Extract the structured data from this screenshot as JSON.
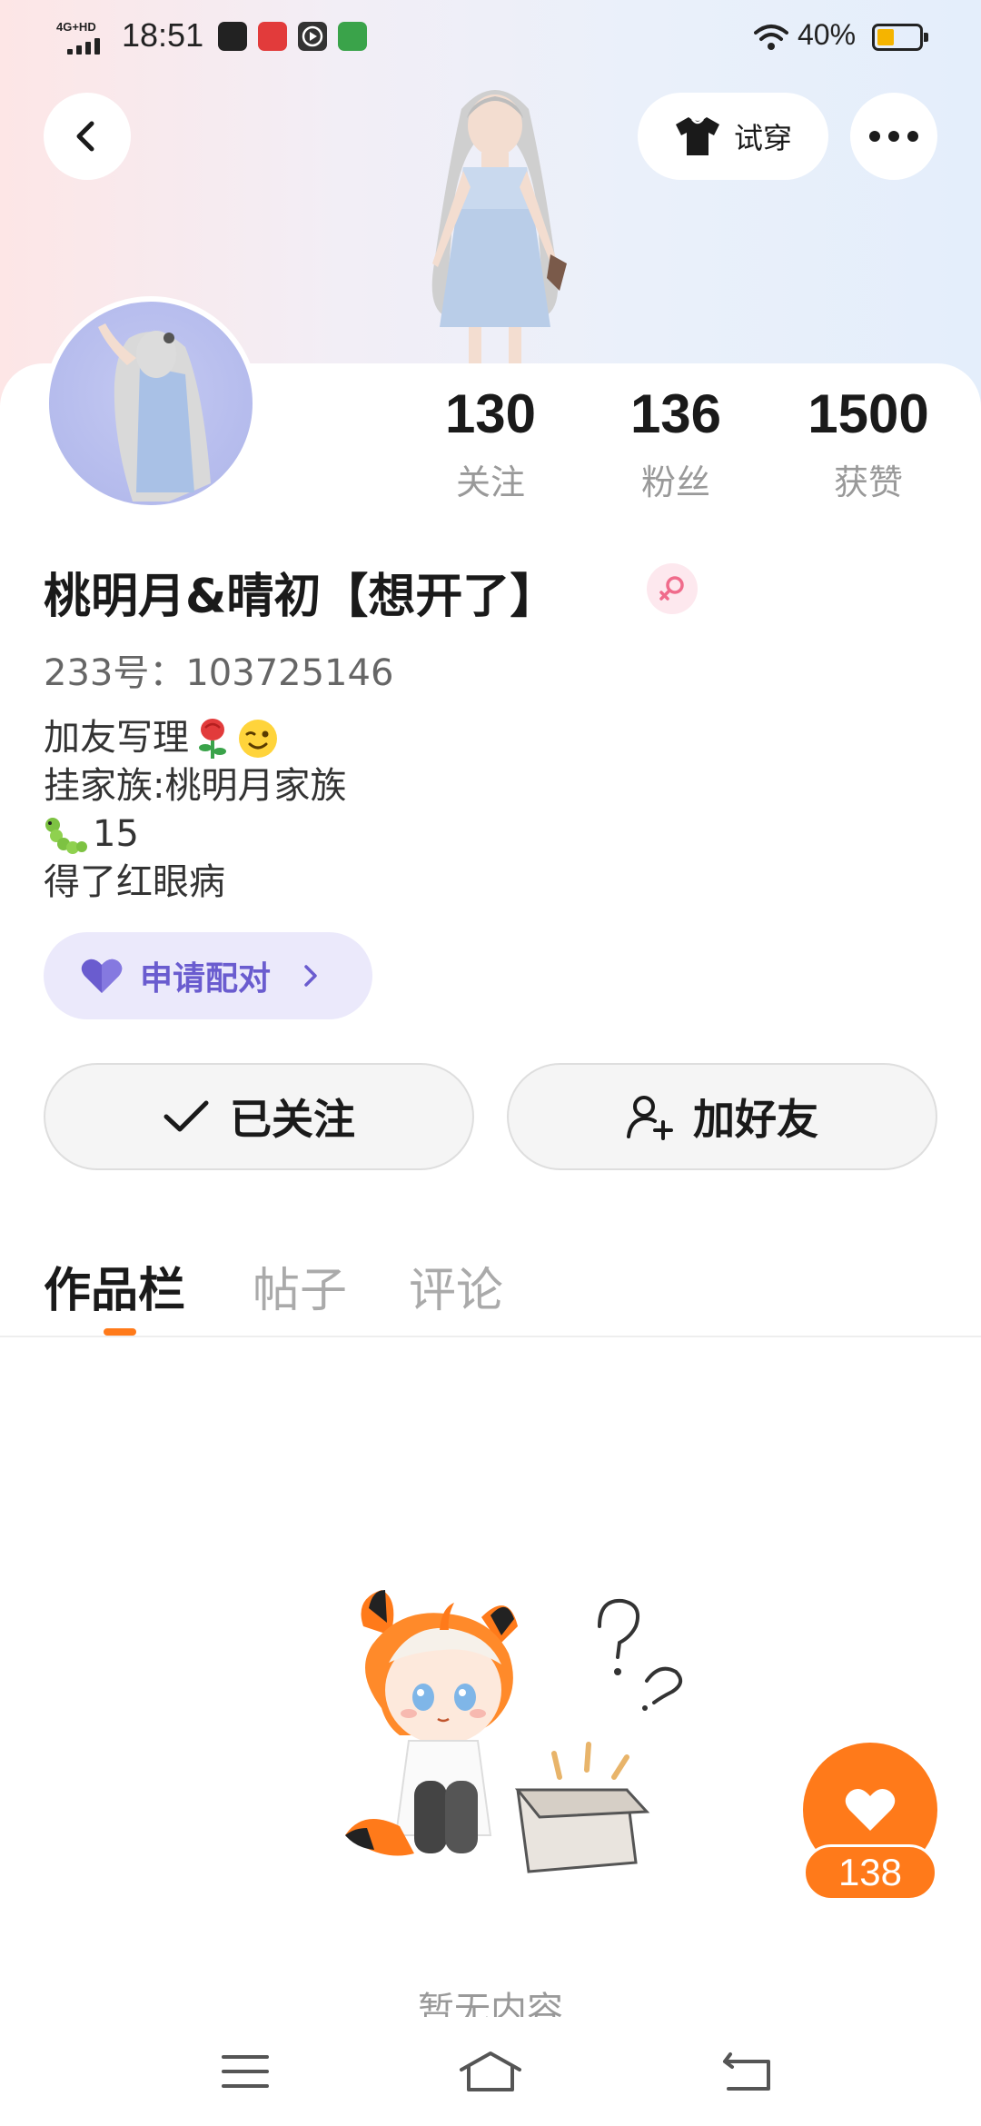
{
  "status_bar": {
    "network": "4G+HD",
    "time": "18:51",
    "battery_percent": "40%",
    "battery_level": 0.4,
    "icons": [
      "wifi-icon",
      "battery-icon"
    ]
  },
  "top_bar": {
    "back_icon": "chevron-left-icon",
    "try_on_label": "试穿",
    "try_on_icon": "tshirt-icon",
    "more_icon": "more-dots-icon"
  },
  "profile": {
    "nickname": "桃明月&晴初【想开了】",
    "gender_icon": "female-icon",
    "uid": "233号：103725146",
    "stats": [
      {
        "value": "130",
        "label": "关注"
      },
      {
        "value": "136",
        "label": "粉丝"
      },
      {
        "value": "1500",
        "label": "获赞"
      }
    ],
    "bio": [
      {
        "text": "加友写理",
        "icons": [
          "rose-icon",
          "wink-emoji-icon"
        ]
      },
      {
        "text": "挂家族:桃明月家族",
        "icons": []
      },
      {
        "text": "15",
        "icons": [
          "caterpillar-icon"
        ]
      },
      {
        "text": "得了红眼病",
        "icons": []
      }
    ]
  },
  "pair_button": {
    "label": "申请配对",
    "icon": "heart-icon"
  },
  "actions": {
    "follow_label": "已关注",
    "follow_icon": "check-icon",
    "add_friend_label": "加好友",
    "add_friend_icon": "add-person-icon"
  },
  "tabs": [
    {
      "label": "作品栏",
      "active": true
    },
    {
      "label": "帖子",
      "active": false
    },
    {
      "label": "评论",
      "active": false
    }
  ],
  "empty_state": {
    "text": "暂无内容"
  },
  "like_fab": {
    "count": "138",
    "icon": "heart-icon"
  },
  "nav_bar": {
    "icons": [
      "menu-icon",
      "home-icon",
      "back-icon"
    ]
  },
  "colors": {
    "accent": "#ff7a1a",
    "pair_bg": "#ebe9fb",
    "pair_text": "#6a5ccf",
    "gender_pink": "#f06b8b"
  }
}
